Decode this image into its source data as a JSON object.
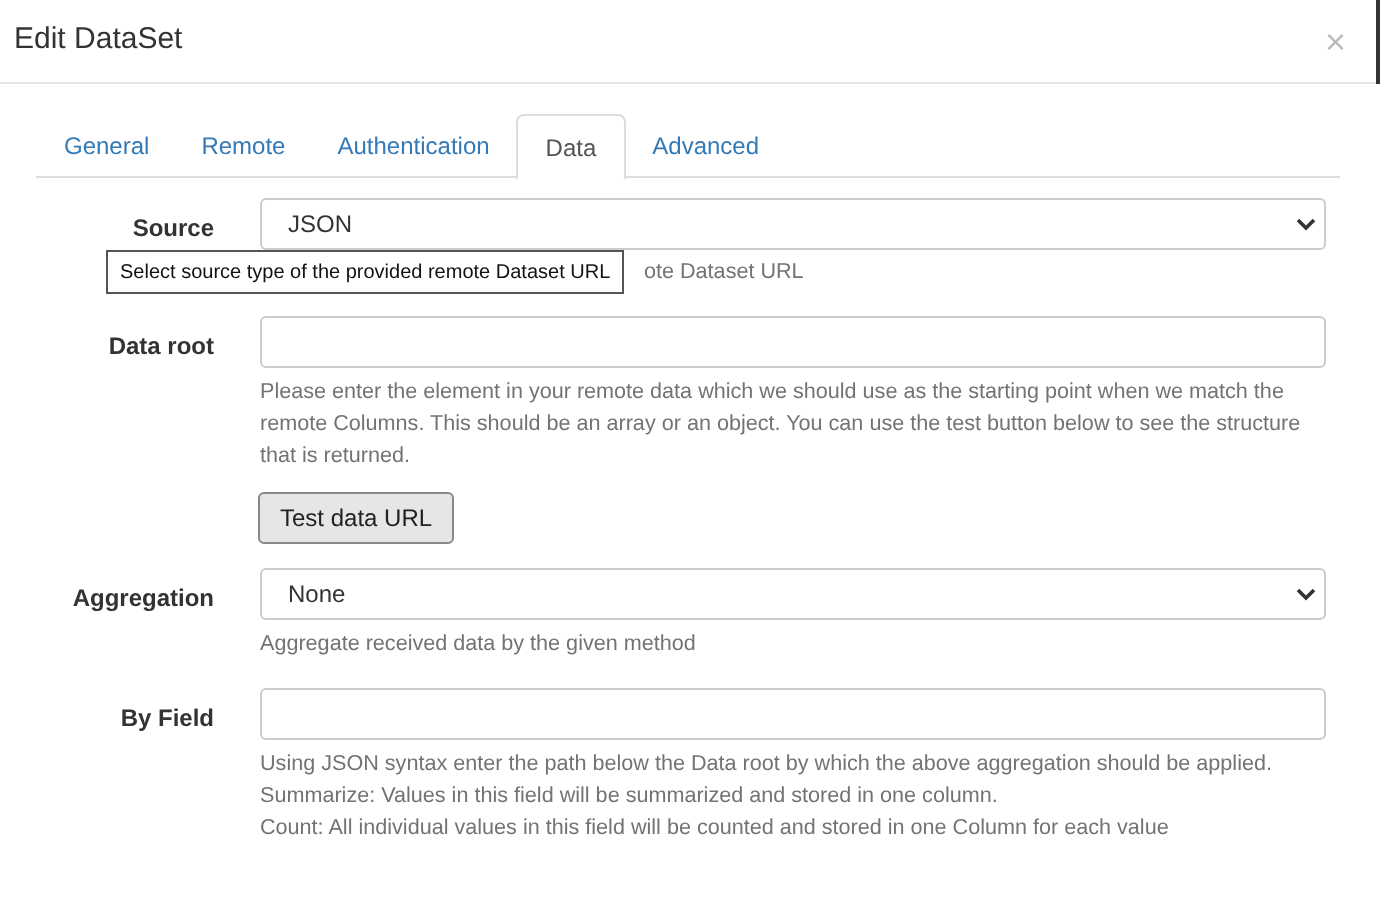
{
  "dialog": {
    "title": "Edit DataSet",
    "close": "×"
  },
  "tabs": [
    {
      "label": "General",
      "selected": false
    },
    {
      "label": "Remote",
      "selected": false
    },
    {
      "label": "Authentication",
      "selected": false
    },
    {
      "label": "Data",
      "selected": true
    },
    {
      "label": "Advanced",
      "selected": false
    }
  ],
  "rows": [
    {
      "kind": "select",
      "label": "Source",
      "value": "JSON",
      "help": [
        "ote Dataset URL"
      ],
      "tooltip": "Select source type of the provided remote Dataset URL"
    },
    {
      "kind": "text",
      "label": "Data root",
      "help": [
        "Please enter the element in your remote data which we should use as the starting point when we match the remote Columns. This should be an array or an object. You can use the test button below to see the structure that is returned."
      ]
    },
    {
      "kind": "button",
      "label": "Test data URL"
    },
    {
      "kind": "select",
      "label": "Aggregation",
      "value": "None",
      "help": [
        "Aggregate received data by the given method"
      ]
    },
    {
      "kind": "text",
      "label": "By Field",
      "help": [
        "Using JSON syntax enter the path below the Data root by which the above aggregation should be applied.",
        "Summarize: Values in this field will be summarized and stored in one column.",
        "Count: All individual values in this field will be counted and stored in one Column for each value"
      ]
    }
  ]
}
